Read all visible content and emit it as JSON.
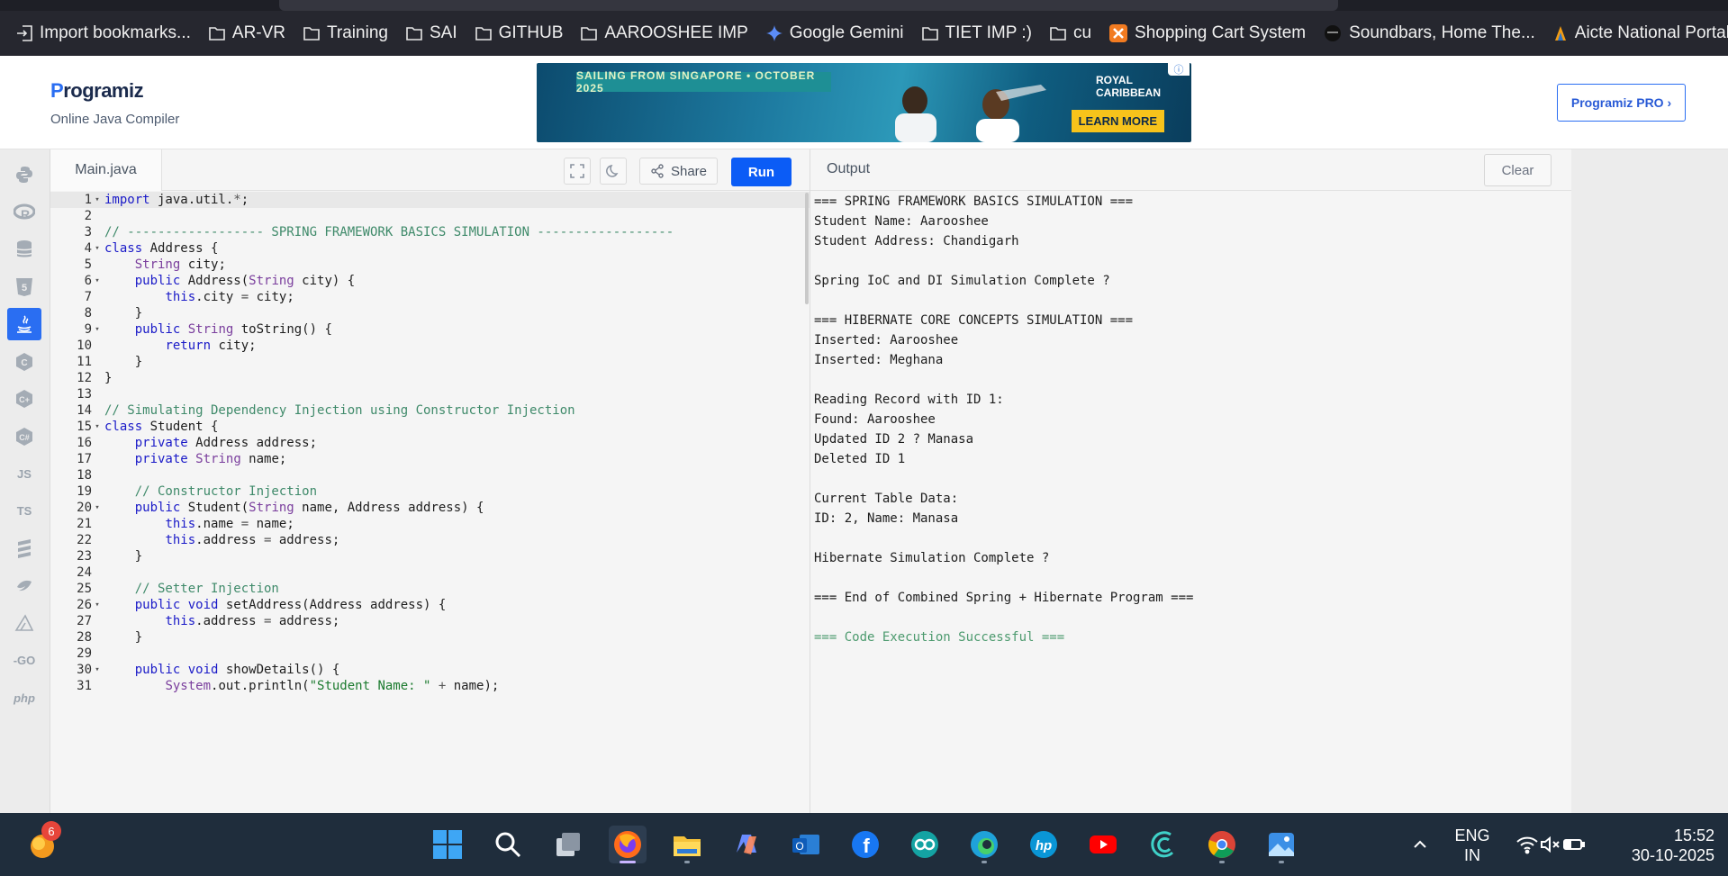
{
  "bookmarks": [
    {
      "label": "Import bookmarks...",
      "icon": "import-icon"
    },
    {
      "label": "AR-VR",
      "icon": "folder-icon"
    },
    {
      "label": "Training",
      "icon": "folder-icon"
    },
    {
      "label": "SAI",
      "icon": "folder-icon"
    },
    {
      "label": "GITHUB",
      "icon": "folder-icon"
    },
    {
      "label": "AAROOSHEE IMP",
      "icon": "folder-icon"
    },
    {
      "label": "Google Gemini",
      "icon": "gemini-icon"
    },
    {
      "label": "TIET IMP :)",
      "icon": "folder-icon"
    },
    {
      "label": "cu",
      "icon": "folder-icon"
    },
    {
      "label": "Shopping Cart System",
      "icon": "xampp-icon"
    },
    {
      "label": "Soundbars, Home The...",
      "icon": "speaker-icon"
    },
    {
      "label": "Aicte National Portal -...",
      "icon": "aicte-icon"
    }
  ],
  "header": {
    "logo_prefix": "P",
    "logo_rest": "rogramiz",
    "subtitle": "Online Java Compiler",
    "pro_button": "Programiz PRO ›"
  },
  "ad": {
    "banner": "SAILING FROM SINGAPORE • OCTOBER 2025",
    "brand_line1": "ROYAL",
    "brand_line2": "CARIBBEAN",
    "cta": "LEARN MORE"
  },
  "languages": [
    {
      "name": "python-icon",
      "label": ""
    },
    {
      "name": "r-icon",
      "label": ""
    },
    {
      "name": "sql-icon",
      "label": ""
    },
    {
      "name": "html-icon",
      "label": ""
    },
    {
      "name": "java-icon",
      "label": "",
      "active": true
    },
    {
      "name": "c-icon",
      "label": ""
    },
    {
      "name": "cpp-icon",
      "label": ""
    },
    {
      "name": "csharp-icon",
      "label": ""
    },
    {
      "name": "js-icon",
      "label": "JS"
    },
    {
      "name": "ts-icon",
      "label": "TS"
    },
    {
      "name": "stack-icon",
      "label": ""
    },
    {
      "name": "swift-icon",
      "label": ""
    },
    {
      "name": "kotlin-icon",
      "label": ""
    },
    {
      "name": "go-icon",
      "label": "-GO"
    },
    {
      "name": "php-icon",
      "label": "php"
    }
  ],
  "editor": {
    "filename": "Main.java",
    "share_label": "Share",
    "run_label": "Run",
    "lines": [
      {
        "n": "1",
        "fold": true,
        "code": "import java.util.*;"
      },
      {
        "n": "2",
        "fold": false,
        "code": ""
      },
      {
        "n": "3",
        "fold": false,
        "code": "// ------------------ SPRING FRAMEWORK BASICS SIMULATION ------------------"
      },
      {
        "n": "4",
        "fold": true,
        "code": "class Address {"
      },
      {
        "n": "5",
        "fold": false,
        "code": "    String city;"
      },
      {
        "n": "6",
        "fold": true,
        "code": "    public Address(String city) {"
      },
      {
        "n": "7",
        "fold": false,
        "code": "        this.city = city;"
      },
      {
        "n": "8",
        "fold": false,
        "code": "    }"
      },
      {
        "n": "9",
        "fold": true,
        "code": "    public String toString() {"
      },
      {
        "n": "10",
        "fold": false,
        "code": "        return city;"
      },
      {
        "n": "11",
        "fold": false,
        "code": "    }"
      },
      {
        "n": "12",
        "fold": false,
        "code": "}"
      },
      {
        "n": "13",
        "fold": false,
        "code": ""
      },
      {
        "n": "14",
        "fold": false,
        "code": "// Simulating Dependency Injection using Constructor Injection"
      },
      {
        "n": "15",
        "fold": true,
        "code": "class Student {"
      },
      {
        "n": "16",
        "fold": false,
        "code": "    private Address address;"
      },
      {
        "n": "17",
        "fold": false,
        "code": "    private String name;"
      },
      {
        "n": "18",
        "fold": false,
        "code": ""
      },
      {
        "n": "19",
        "fold": false,
        "code": "    // Constructor Injection"
      },
      {
        "n": "20",
        "fold": true,
        "code": "    public Student(String name, Address address) {"
      },
      {
        "n": "21",
        "fold": false,
        "code": "        this.name = name;"
      },
      {
        "n": "22",
        "fold": false,
        "code": "        this.address = address;"
      },
      {
        "n": "23",
        "fold": false,
        "code": "    }"
      },
      {
        "n": "24",
        "fold": false,
        "code": ""
      },
      {
        "n": "25",
        "fold": false,
        "code": "    // Setter Injection"
      },
      {
        "n": "26",
        "fold": true,
        "code": "    public void setAddress(Address address) {"
      },
      {
        "n": "27",
        "fold": false,
        "code": "        this.address = address;"
      },
      {
        "n": "28",
        "fold": false,
        "code": "    }"
      },
      {
        "n": "29",
        "fold": false,
        "code": ""
      },
      {
        "n": "30",
        "fold": true,
        "code": "    public void showDetails() {"
      },
      {
        "n": "31",
        "fold": false,
        "code": "        System.out.println(\"Student Name: \" + name);"
      }
    ]
  },
  "output": {
    "title": "Output",
    "clear_label": "Clear",
    "lines": [
      "=== SPRING FRAMEWORK BASICS SIMULATION ===",
      "Student Name: Aarooshee",
      "Student Address: Chandigarh",
      "",
      "Spring IoC and DI Simulation Complete ?",
      "",
      "=== HIBERNATE CORE CONCEPTS SIMULATION ===",
      "Inserted: Aarooshee",
      "Inserted: Meghana",
      "",
      "Reading Record with ID 1:",
      "Found: Aarooshee",
      "Updated ID 2 ? Manasa",
      "Deleted ID 1",
      "",
      "Current Table Data:",
      "ID: 2, Name: Manasa",
      "",
      "Hibernate Simulation Complete ?",
      "",
      "=== End of Combined Spring + Hibernate Program ===",
      ""
    ],
    "success_line": "=== Code Execution Successful ==="
  },
  "taskbar": {
    "notification_count": "6",
    "lang_line1": "ENG",
    "lang_line2": "IN",
    "time": "15:52",
    "date": "30-10-2025"
  },
  "colors": {
    "run": "#0b5cf6",
    "keyword": "#1a1ac8",
    "type": "#7a3e9d",
    "comment": "#3f8a6a",
    "string": "#1b7a2e",
    "success": "#4c9a6e"
  }
}
